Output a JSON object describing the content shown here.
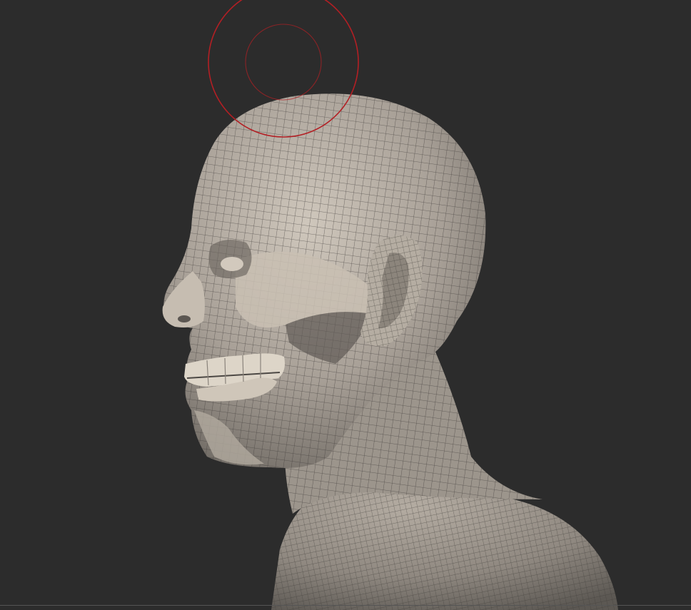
{
  "viewport": {
    "background": "#2c2c2c",
    "model": {
      "skin_color": "#b9b0a4",
      "skin_shadow": "#6f6962",
      "teeth_color": "#d8d0c2",
      "wire_color": "#3a3735"
    },
    "brush_cursor": {
      "icon": "brush-cursor-icon",
      "color": "#b31f24"
    }
  },
  "footer_line_color": "#555555"
}
